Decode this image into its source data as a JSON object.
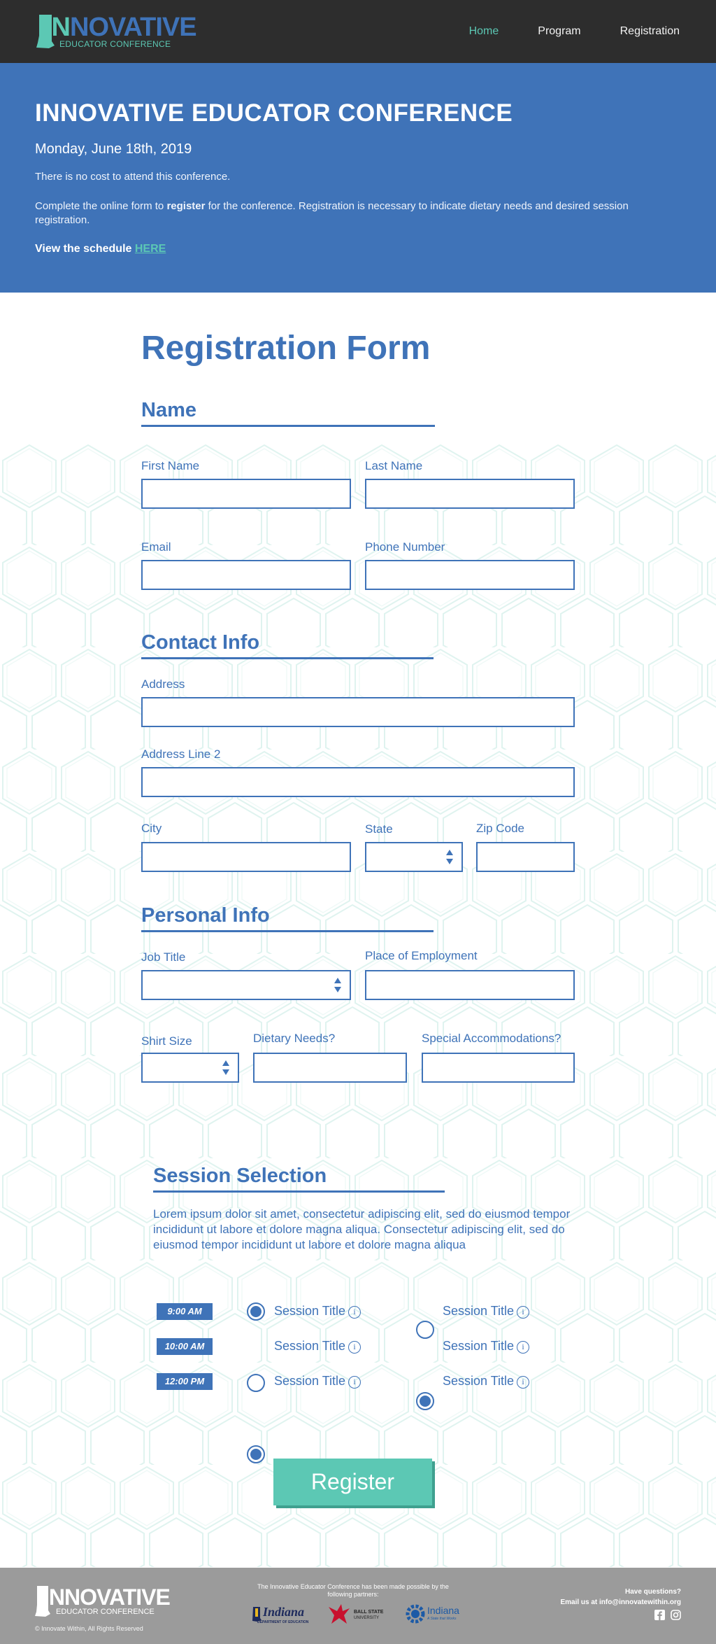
{
  "nav": {
    "logo_in": "IN",
    "logo_rest": "NOVATIVE",
    "logo_sub": "EDUCATOR CONFERENCE",
    "links": [
      "Home",
      "Program",
      "Registration"
    ]
  },
  "hero": {
    "title": "INNOVATIVE EDUCATOR CONFERENCE",
    "date": "Monday, June 18th, 2019",
    "cost": "There is no cost to attend this conference.",
    "complete_pre": "Complete the online form to ",
    "complete_bold": "register",
    "complete_post": " for the conference. Registration is necessary to indicate dietary needs and desired session registration.",
    "schedule_text": "View the schedule ",
    "schedule_link": "HERE"
  },
  "form": {
    "title": "Registration Form",
    "name_section": "Name",
    "first_name": "First Name",
    "last_name": "Last Name",
    "email": "Email",
    "phone": "Phone Number",
    "contact_section": "Contact Info",
    "address": "Address",
    "address2": "Address Line 2",
    "city": "City",
    "state": "State",
    "zip": "Zip Code",
    "personal_section": "Personal Info",
    "job_title": "Job Title",
    "employment": "Place of Employment",
    "shirt": "Shirt Size",
    "dietary": "Dietary Needs?",
    "accommodations": "Special Accommodations?",
    "session_section": "Session Selection",
    "lorem": "Lorem ipsum dolor sit amet, consectetur adipiscing elit, sed do eiusmod tempor incididunt ut labore et dolore magna aliqua. Consectetur adipiscing elit, sed do eiusmod tempor incididunt ut labore et dolore magna aliqua",
    "sessions": [
      {
        "time": "9:00 AM",
        "a_label": "Session Title",
        "a_checked": true,
        "b_label": "Session Title",
        "b_checked": false
      },
      {
        "time": "10:00 AM",
        "a_label": "Session Title",
        "a_checked": false,
        "b_label": "Session Title",
        "b_checked": true
      },
      {
        "time": "12:00 PM",
        "a_label": "Session Title",
        "a_checked": true,
        "b_label": "Session Title",
        "b_checked": false
      }
    ],
    "register": "Register"
  },
  "footer": {
    "logo_word": "INNOVATIVE",
    "logo_sub": "EDUCATOR CONFERENCE",
    "copyright": "© Innovate Within, All Rights Reserved",
    "partners_text": "The Innovative Educator Conference has been made possible by the following partners:",
    "partner_indiana_doe": "Indiana",
    "partner_indiana_doe_sub": "DEPARTMENT OF EDUCATION",
    "partner_bsu": "BALL STATE",
    "partner_bsu_sub": "UNIVERSITY",
    "partner_indiana_state": "Indiana",
    "partner_indiana_state_sub": "A State that Works",
    "questions": "Have questions?",
    "email_line": "Email us at info@innovatewithin.org"
  },
  "colors": {
    "nav_bg": "#2d2d2d",
    "brand_blue": "#3f73b8",
    "accent_teal": "#5cc8b4",
    "footer_bg": "#9b9b9b"
  }
}
